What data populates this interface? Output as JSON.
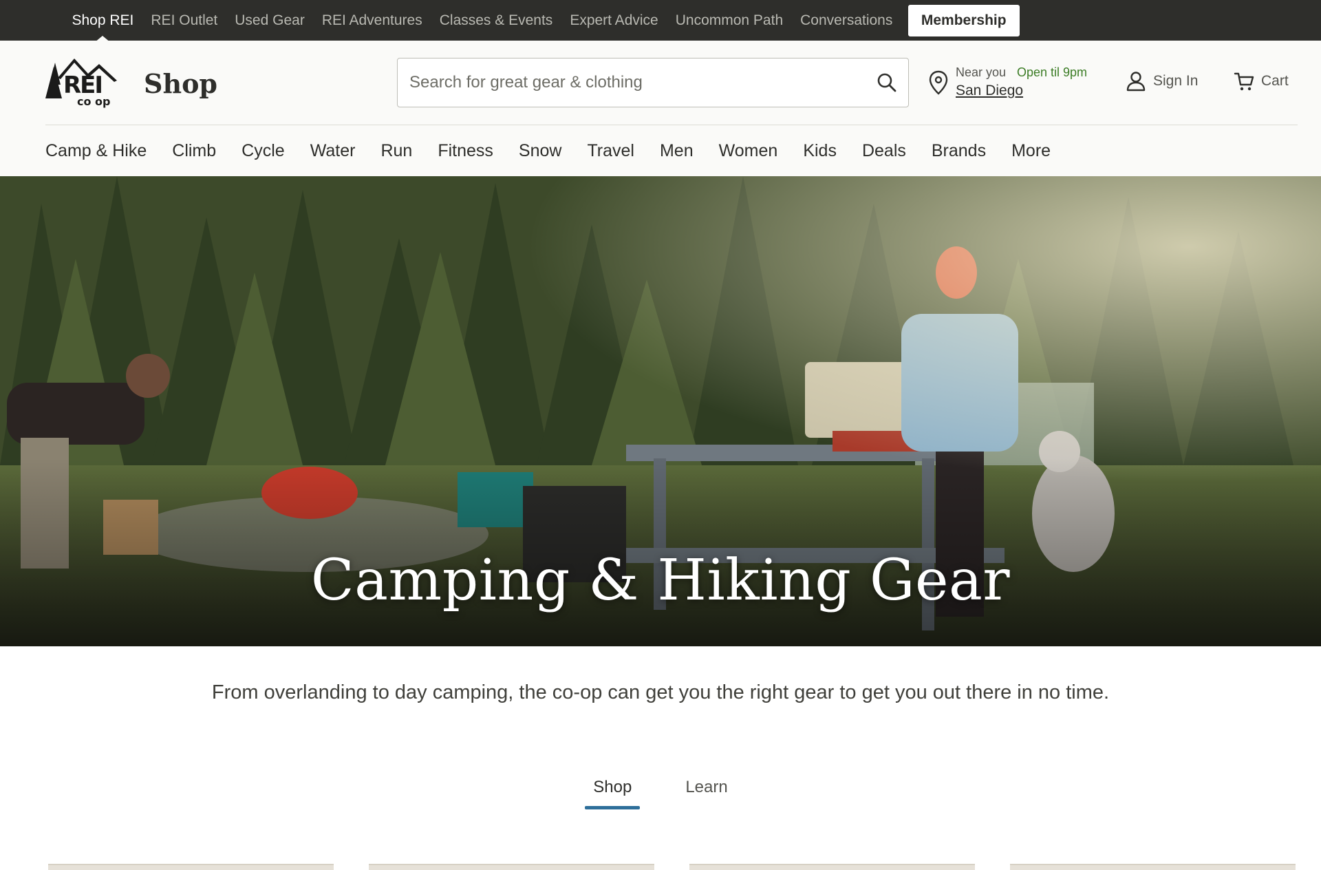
{
  "utility_bar": {
    "links": [
      {
        "label": "Shop REI",
        "active": true
      },
      {
        "label": "REI Outlet",
        "active": false
      },
      {
        "label": "Used Gear",
        "active": false
      },
      {
        "label": "REI Adventures",
        "active": false
      },
      {
        "label": "Classes & Events",
        "active": false
      },
      {
        "label": "Expert Advice",
        "active": false
      },
      {
        "label": "Uncommon Path",
        "active": false
      },
      {
        "label": "Conversations",
        "active": false
      }
    ],
    "membership_label": "Membership"
  },
  "header": {
    "logo_text": "REI co op",
    "shop_title": "Shop",
    "search": {
      "placeholder": "Search for great gear & clothing",
      "value": ""
    },
    "store": {
      "near_label": "Near you",
      "status": "Open til 9pm",
      "name": "San Diego"
    },
    "signin_label": "Sign In",
    "cart_label": "Cart"
  },
  "category_nav": [
    "Camp & Hike",
    "Climb",
    "Cycle",
    "Water",
    "Run",
    "Fitness",
    "Snow",
    "Travel",
    "Men",
    "Women",
    "Kids",
    "Deals",
    "Brands",
    "More"
  ],
  "hero": {
    "title": "Camping & Hiking Gear"
  },
  "intro": "From overlanding to day camping, the co-op can get you the right gear to get you out there in no time.",
  "tabs": [
    {
      "label": "Shop",
      "active": true
    },
    {
      "label": "Learn",
      "active": false
    }
  ],
  "colors": {
    "utility_bg": "#2e2e2b",
    "header_bg": "#fafaf8",
    "open_status": "#3b7c25",
    "tab_underline": "#2e6f9a"
  }
}
